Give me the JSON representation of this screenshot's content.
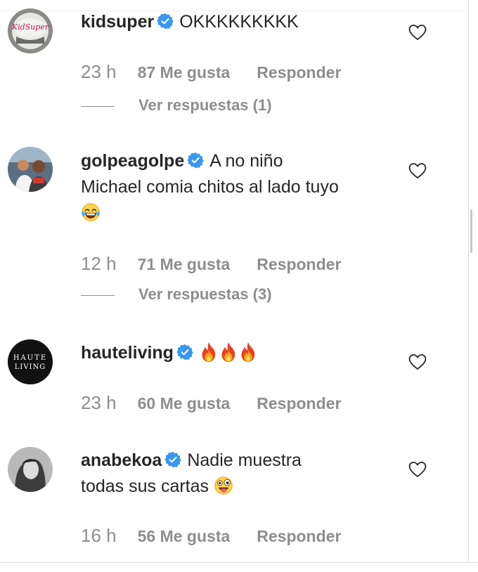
{
  "comments": [
    {
      "username": "kidsuper",
      "text": "OKKKKKKKKK",
      "time": "23 h",
      "likes": "87 Me gusta",
      "reply": "Responder",
      "view_replies": "Ver respuestas (1)",
      "avatar_text": "KidSuper"
    },
    {
      "username": "golpeagolpe",
      "text_line1": "A no niño",
      "text_line2": "Michael comia chitos al lado tuyo",
      "time": "12 h",
      "likes": "71 Me gusta",
      "reply": "Responder",
      "view_replies": "Ver respuestas (3)"
    },
    {
      "username": "hauteliving",
      "text": "",
      "time": "23 h",
      "likes": "60 Me gusta",
      "reply": "Responder",
      "avatar_line1": "HAUTE",
      "avatar_line2": "LIVING"
    },
    {
      "username": "anabekoa",
      "text_line1": "Nadie muestra",
      "text_line2": "todas sus cartas",
      "time": "16 h",
      "likes": "56 Me gusta",
      "reply": "Responder"
    }
  ],
  "icons": {
    "verified": "verified-badge-icon",
    "like": "heart-outline-icon",
    "emoji_laugh": "face-with-tears-of-joy",
    "emoji_fire": "fire",
    "emoji_tongue": "zany-face"
  },
  "colors": {
    "text": "#262626",
    "secondary": "#8e8e8e",
    "verified": "#3897f0"
  }
}
